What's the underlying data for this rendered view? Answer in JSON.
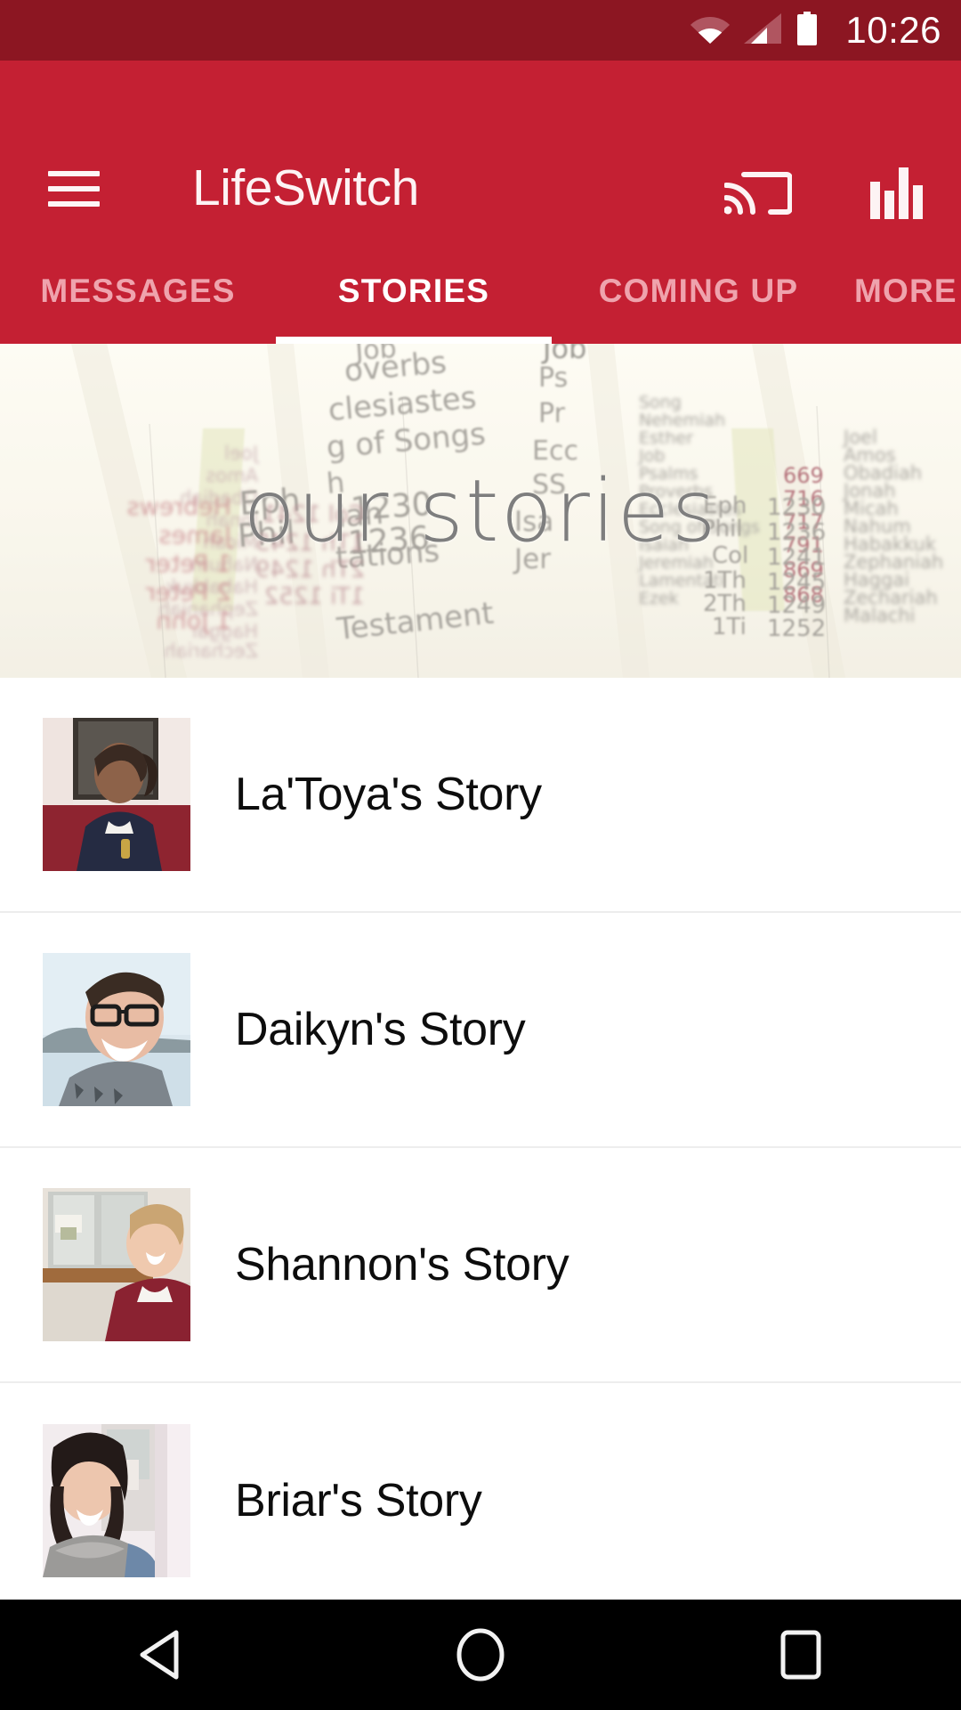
{
  "status_bar": {
    "time": "10:26",
    "wifi_icon": "wifi-icon",
    "signal_icon": "cell-signal-icon",
    "battery_icon": "battery-full-icon",
    "background_color": "#8c1622"
  },
  "app_bar": {
    "title": "LifeSwitch",
    "menu_icon": "hamburger-menu-icon",
    "cast_icon": "cast-icon",
    "chart_icon": "bar-chart-icon",
    "background_color": "#c42033",
    "text_color": "#ffffff"
  },
  "tabs": {
    "items": [
      {
        "label": "MESSAGES",
        "active": false
      },
      {
        "label": "STORIES",
        "active": true
      },
      {
        "label": "COMING UP",
        "active": false
      },
      {
        "label": "MORE",
        "active": false
      }
    ],
    "active_index": 1,
    "active_color": "#ffffff",
    "inactive_color": "#efa3ad",
    "indicator_color": "#ffffff"
  },
  "hero": {
    "title": "our stories",
    "title_color": "#7e7e7e",
    "background_color": "#f7f6ef",
    "page_labels": [
      "Job",
      "Ps",
      "Pr",
      "Ecc",
      "SS",
      "Isa",
      "Jer",
      "overbs",
      "clesiastes",
      "g of Songs",
      "tations",
      "Testament",
      "Hebrews",
      "James",
      "1 Peter",
      "2 Peter",
      "Eph",
      "Phil",
      "Col",
      "Nahum",
      "Habakkuk",
      "Zephaniah",
      "Haggai",
      "Zechariah",
      "Malachi",
      "Micah",
      "Jeremiah"
    ],
    "page_numbers": [
      "716",
      "717",
      "791",
      "869",
      "868",
      "1230",
      "1236",
      "1241",
      "1245",
      "1249",
      "1252"
    ]
  },
  "stories": {
    "items": [
      {
        "title": "La'Toya's Story",
        "thumbnail": "latoya-thumbnail"
      },
      {
        "title": "Daikyn's Story",
        "thumbnail": "daikyn-thumbnail"
      },
      {
        "title": "Shannon's Story",
        "thumbnail": "shannon-thumbnail"
      },
      {
        "title": "Briar's Story",
        "thumbnail": "briar-thumbnail"
      }
    ],
    "divider_color": "#ededed",
    "title_color": "#0d0d0d"
  },
  "nav_bar": {
    "back_icon": "back-triangle-icon",
    "home_icon": "home-circle-icon",
    "recents_icon": "recents-square-icon",
    "background_color": "#000000"
  }
}
